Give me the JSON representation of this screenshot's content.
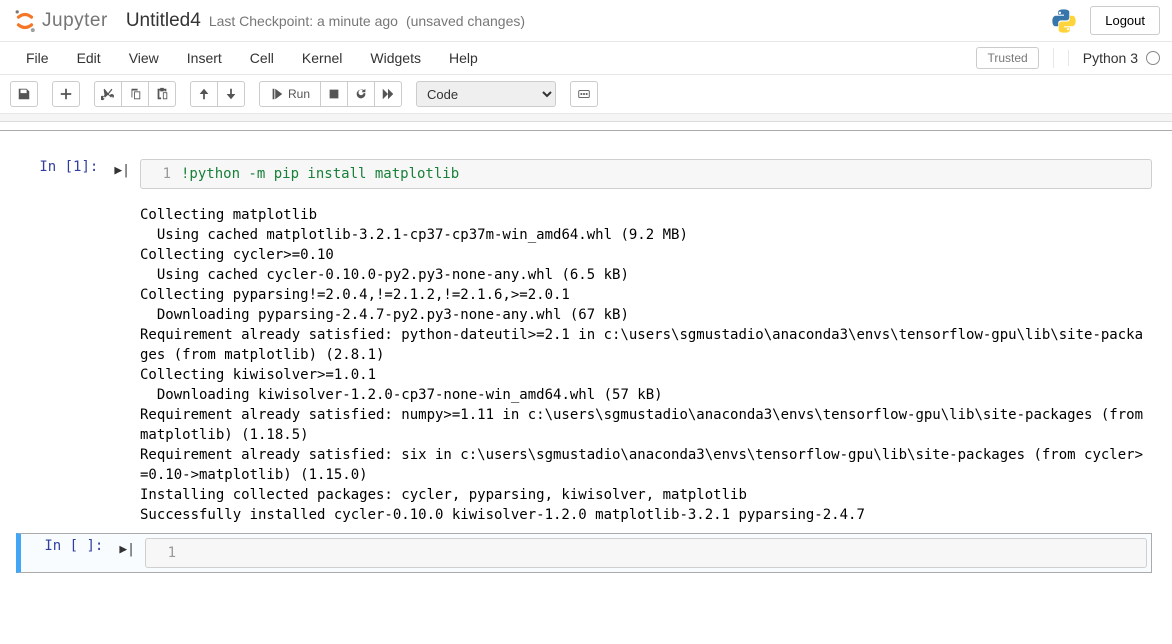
{
  "header": {
    "logo_text": "Jupyter",
    "notebook_name": "Untitled4",
    "checkpoint": "Last Checkpoint: a minute ago",
    "unsaved": "(unsaved changes)",
    "logout": "Logout"
  },
  "menubar": {
    "items": [
      "File",
      "Edit",
      "View",
      "Insert",
      "Cell",
      "Kernel",
      "Widgets",
      "Help"
    ],
    "trusted": "Trusted",
    "kernel": "Python 3"
  },
  "toolbar": {
    "run_label": "Run",
    "cell_type": "Code"
  },
  "cells": [
    {
      "prompt": "In [1]:",
      "line_no": "1",
      "code": "!python -m pip install matplotlib",
      "output": "Collecting matplotlib\n  Using cached matplotlib-3.2.1-cp37-cp37m-win_amd64.whl (9.2 MB)\nCollecting cycler>=0.10\n  Using cached cycler-0.10.0-py2.py3-none-any.whl (6.5 kB)\nCollecting pyparsing!=2.0.4,!=2.1.2,!=2.1.6,>=2.0.1\n  Downloading pyparsing-2.4.7-py2.py3-none-any.whl (67 kB)\nRequirement already satisfied: python-dateutil>=2.1 in c:\\users\\sgmustadio\\anaconda3\\envs\\tensorflow-gpu\\lib\\site-packages (from matplotlib) (2.8.1)\nCollecting kiwisolver>=1.0.1\n  Downloading kiwisolver-1.2.0-cp37-none-win_amd64.whl (57 kB)\nRequirement already satisfied: numpy>=1.11 in c:\\users\\sgmustadio\\anaconda3\\envs\\tensorflow-gpu\\lib\\site-packages (from matplotlib) (1.18.5)\nRequirement already satisfied: six in c:\\users\\sgmustadio\\anaconda3\\envs\\tensorflow-gpu\\lib\\site-packages (from cycler>=0.10->matplotlib) (1.15.0)\nInstalling collected packages: cycler, pyparsing, kiwisolver, matplotlib\nSuccessfully installed cycler-0.10.0 kiwisolver-1.2.0 matplotlib-3.2.1 pyparsing-2.4.7"
    },
    {
      "prompt": "In [ ]:",
      "line_no": "1",
      "code": ""
    }
  ]
}
